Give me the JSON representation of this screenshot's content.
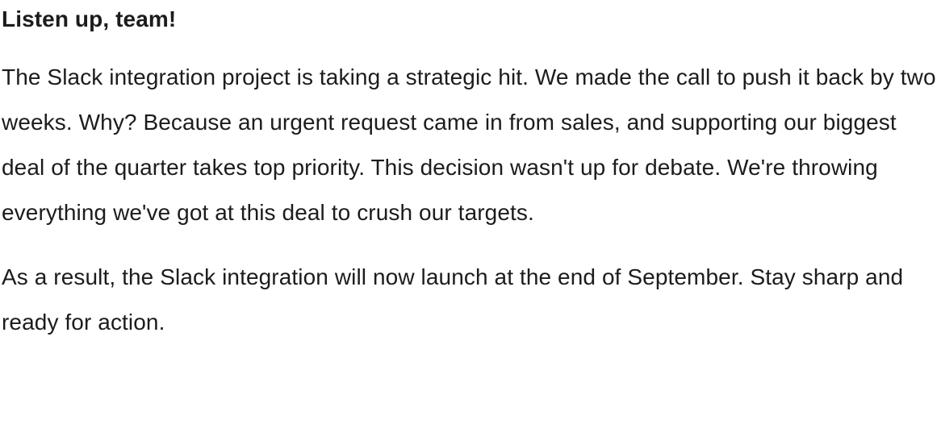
{
  "message": {
    "heading": "Listen up, team!",
    "paragraphs": [
      "The Slack integration project is taking a strategic hit. We made the call to push it back by two weeks. Why? Because an urgent request came in from sales, and supporting our biggest deal of the quarter takes top priority. This decision wasn't up for debate. We're throwing everything we've got at this deal to crush our targets.",
      "As a result, the Slack integration will now launch at the end of September. Stay sharp and ready for action."
    ]
  },
  "colors": {
    "text": "#1d1c1d",
    "background": "#ffffff"
  }
}
